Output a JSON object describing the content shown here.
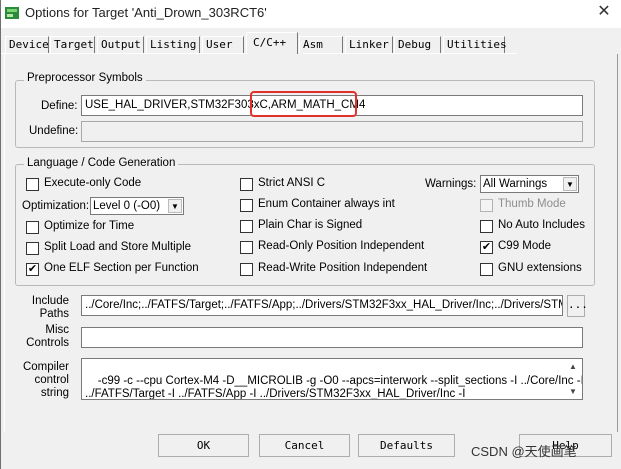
{
  "window": {
    "title": "Options for Target 'Anti_Drown_303RCT6'"
  },
  "tabs": [
    {
      "label": "Device"
    },
    {
      "label": "Target"
    },
    {
      "label": "Output"
    },
    {
      "label": "Listing"
    },
    {
      "label": "User"
    },
    {
      "label": "C/C++"
    },
    {
      "label": "Asm"
    },
    {
      "label": "Linker"
    },
    {
      "label": "Debug"
    },
    {
      "label": "Utilities"
    }
  ],
  "preprocessor": {
    "legend": "Preprocessor Symbols",
    "define_label": "Define:",
    "define_value": "USE_HAL_DRIVER,STM32F303xC,ARM_MATH_CM4",
    "undefine_label": "Undefine:",
    "undefine_value": ""
  },
  "language": {
    "legend": "Language / Code Generation",
    "execute_only": {
      "label": "Execute-only Code",
      "checked": false
    },
    "optimization_label": "Optimization:",
    "optimization_value": "Level 0 (-O0)",
    "optimize_time": {
      "label": "Optimize for Time",
      "checked": false
    },
    "split_load": {
      "label": "Split Load and Store Multiple",
      "checked": false
    },
    "one_elf": {
      "label": "One ELF Section per Function",
      "checked": true
    },
    "strict_ansi": {
      "label": "Strict ANSI C",
      "checked": false
    },
    "enum_container": {
      "label": "Enum Container always int",
      "checked": false
    },
    "plain_char": {
      "label": "Plain Char is Signed",
      "checked": false
    },
    "ro_pos": {
      "label": "Read-Only Position Independent",
      "checked": false
    },
    "rw_pos": {
      "label": "Read-Write Position Independent",
      "checked": false
    },
    "warnings_label": "Warnings:",
    "warnings_value": "All Warnings",
    "thumb_mode": {
      "label": "Thumb Mode",
      "checked": false
    },
    "no_auto_includes": {
      "label": "No Auto Includes",
      "checked": false
    },
    "c99_mode": {
      "label": "C99 Mode",
      "checked": true
    },
    "gnu_ext": {
      "label": "GNU extensions",
      "checked": false
    }
  },
  "paths": {
    "include_label": "Include\nPaths",
    "include_value": "../Core/Inc;../FATFS/Target;../FATFS/App;../Drivers/STM32F3xx_HAL_Driver/Inc;../Drivers/STM3",
    "browse_label": "...",
    "misc_label": "Misc\nControls",
    "misc_value": "",
    "compiler_label": "Compiler\ncontrol\nstring",
    "compiler_value": "-c99 -c --cpu Cortex-M4 -D__MICROLIB -g -O0 --apcs=interwork --split_sections -I ../Core/Inc -I\n../FATFS/Target -I ../FATFS/App -I ../Drivers/STM32F3xx_HAL_Driver/Inc -I"
  },
  "buttons": {
    "ok": "OK",
    "cancel": "Cancel",
    "defaults": "Defaults",
    "help": "Help"
  },
  "watermark": "CSDN @天使画笔",
  "colors": {
    "highlight": "#e2302a",
    "dialog_bg": "#f0f0f0"
  }
}
